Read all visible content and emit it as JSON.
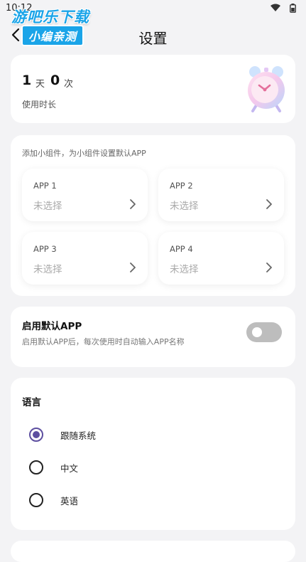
{
  "status_bar": {
    "time": "10:12"
  },
  "watermark": {
    "line1": "游吧乐下载",
    "line2": "小编亲测"
  },
  "header": {
    "title": "设置"
  },
  "usage": {
    "days": "1",
    "days_unit": "天",
    "times": "0",
    "times_unit": "次",
    "label": "使用时长"
  },
  "widget": {
    "heading": "添加小组件，为小组件设置默认APP",
    "apps": [
      {
        "name": "APP 1",
        "value": "未选择"
      },
      {
        "name": "APP 2",
        "value": "未选择"
      },
      {
        "name": "APP 3",
        "value": "未选择"
      },
      {
        "name": "APP 4",
        "value": "未选择"
      }
    ]
  },
  "default_app": {
    "title": "启用默认APP",
    "desc": "启用默认APP后，每次使用时自动输入APP名称",
    "enabled": false
  },
  "language": {
    "title": "语言",
    "options": [
      {
        "label": "跟随系统",
        "selected": true
      },
      {
        "label": "中文",
        "selected": false
      },
      {
        "label": "英语",
        "selected": false
      }
    ]
  },
  "colors": {
    "accent": "#5d4fa0",
    "background": "#f3f3f5",
    "toggle_off": "#bdbdbd"
  }
}
